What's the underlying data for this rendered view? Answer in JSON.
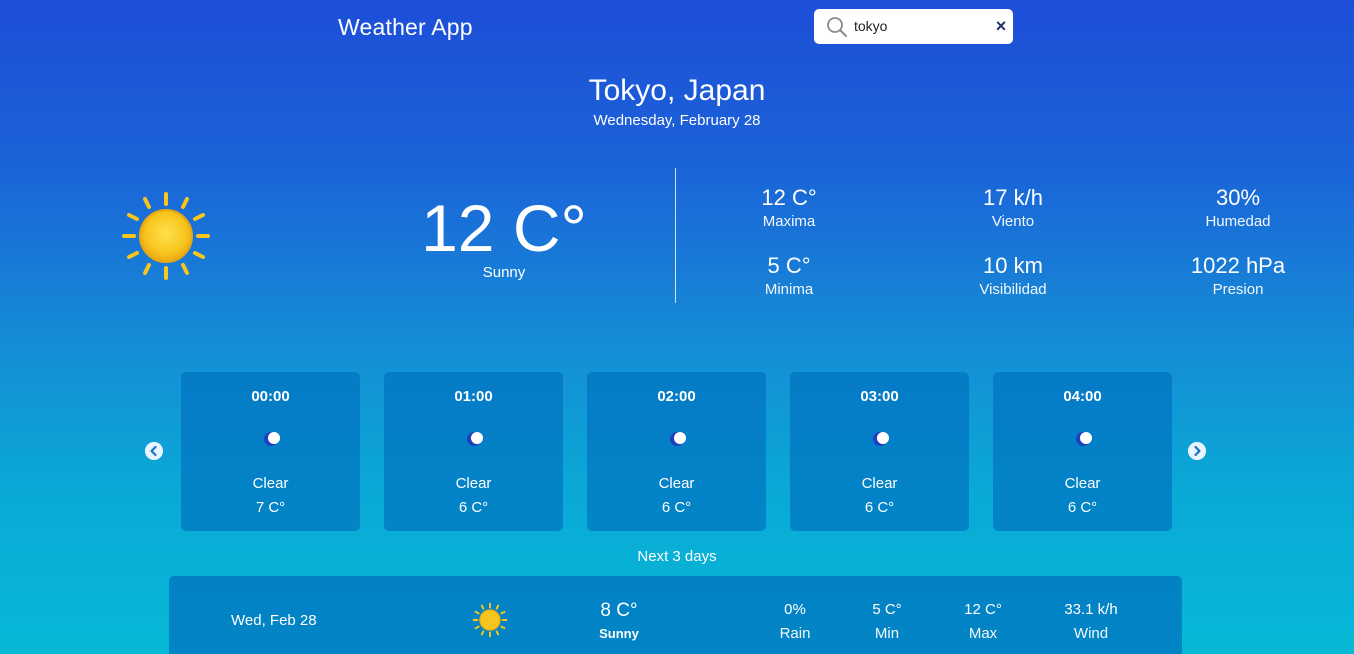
{
  "app": {
    "title": "Weather App"
  },
  "search": {
    "value": "tokyo",
    "placeholder": "",
    "icon": "search-icon",
    "clear_icon": "close-icon"
  },
  "location": {
    "name": "Tokyo, Japan",
    "date": "Wednesday, February 28"
  },
  "current": {
    "icon": "sun-icon",
    "temperature": "12 C°",
    "condition": "Sunny",
    "stats": [
      {
        "value": "12 C°",
        "label": "Maxima"
      },
      {
        "value": "17 k/h",
        "label": "Viento"
      },
      {
        "value": "30%",
        "label": "Humedad"
      },
      {
        "value": "5 C°",
        "label": "Minima"
      },
      {
        "value": "10 km",
        "label": "Visibilidad"
      },
      {
        "value": "1022 hPa",
        "label": "Presion"
      }
    ]
  },
  "hourly": [
    {
      "time": "00:00",
      "icon": "moon-icon",
      "condition": "Clear",
      "temp": "7 C°"
    },
    {
      "time": "01:00",
      "icon": "moon-icon",
      "condition": "Clear",
      "temp": "6 C°"
    },
    {
      "time": "02:00",
      "icon": "moon-icon",
      "condition": "Clear",
      "temp": "6 C°"
    },
    {
      "time": "03:00",
      "icon": "moon-icon",
      "condition": "Clear",
      "temp": "6 C°"
    },
    {
      "time": "04:00",
      "icon": "moon-icon",
      "condition": "Clear",
      "temp": "6 C°"
    }
  ],
  "forecast": {
    "heading": "Next 3 days",
    "days": [
      {
        "date": "Wed, Feb 28",
        "icon": "sun-icon",
        "temp": "8 C°",
        "condition": "Sunny",
        "rain": {
          "value": "0%",
          "label": "Rain"
        },
        "min": {
          "value": "5 C°",
          "label": "Min"
        },
        "max": {
          "value": "12 C°",
          "label": "Max"
        },
        "wind": {
          "value": "33.1 k/h",
          "label": "Wind"
        }
      }
    ]
  },
  "colors": {
    "background_top": "#1d4ed8",
    "background_bottom": "#06b9d6",
    "card": "#0a78c4",
    "sun": "#f7c51e",
    "moon": "#1e3fbf"
  }
}
